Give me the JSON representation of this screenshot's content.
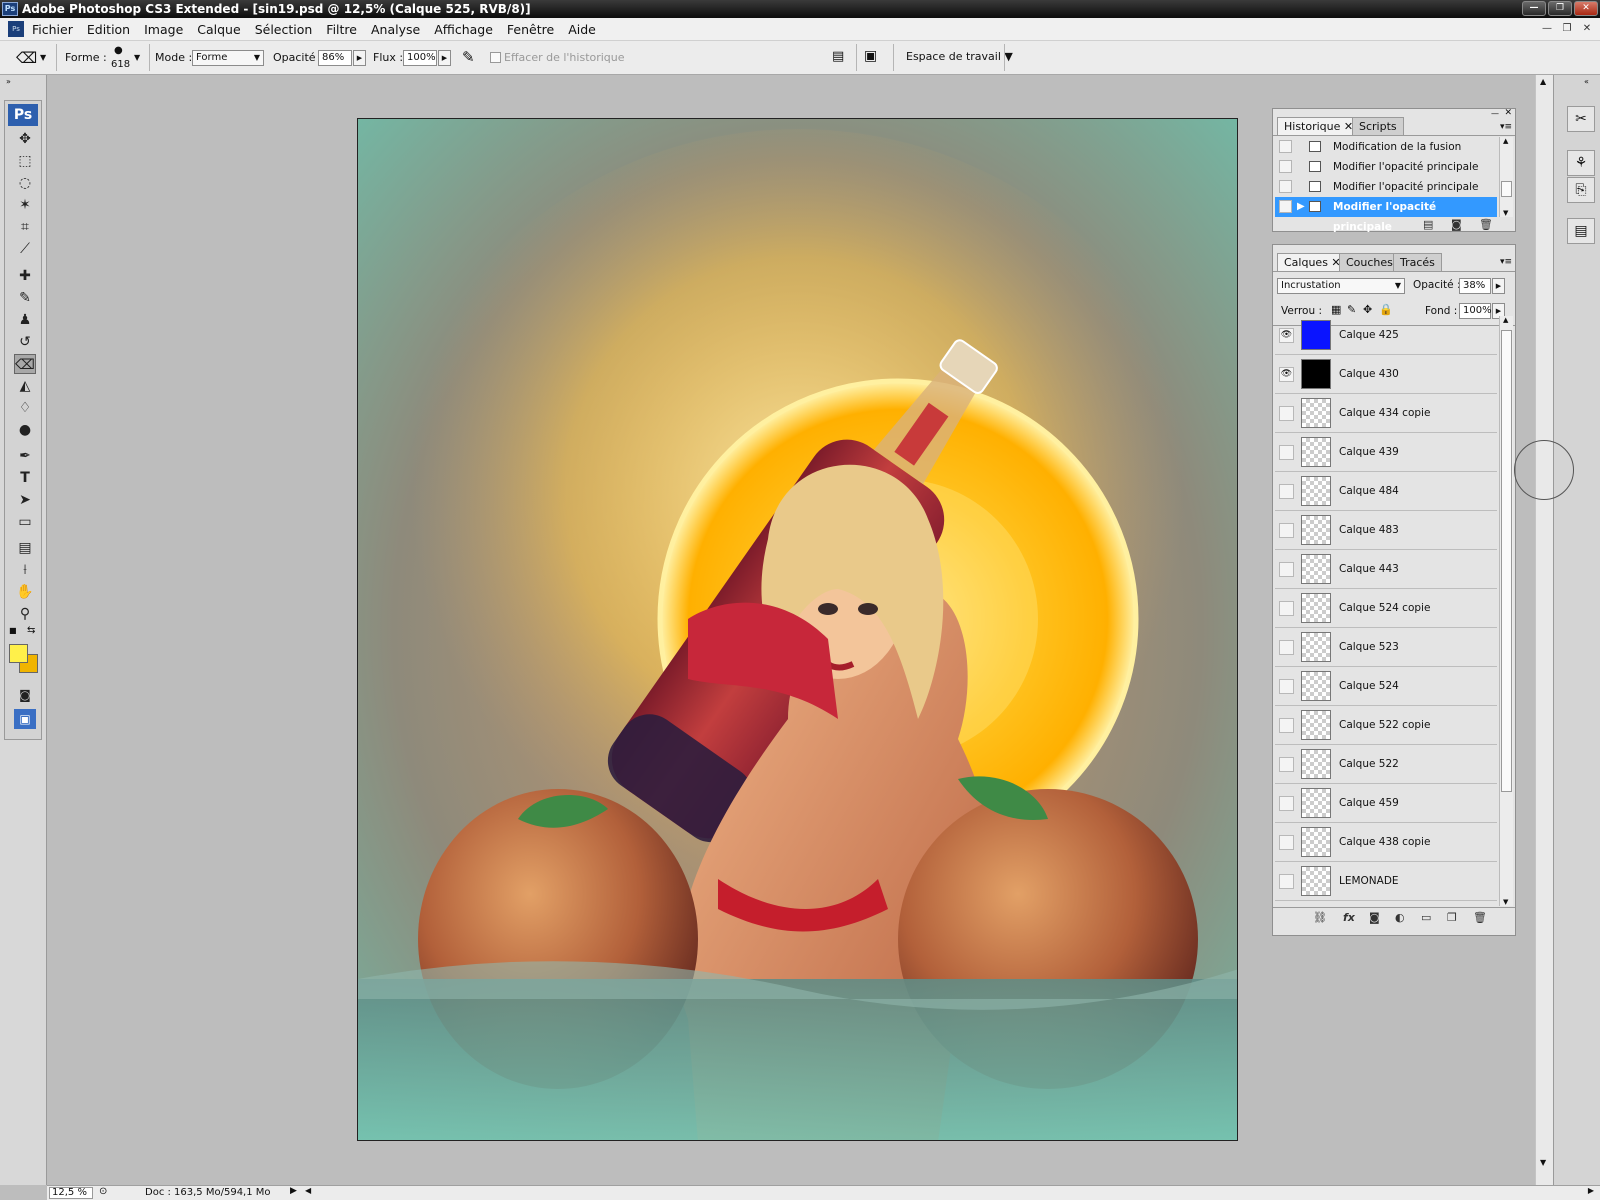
{
  "window": {
    "title": "Adobe Photoshop CS3 Extended - [sin19.psd @ 12,5% (Calque 525, RVB/8)]",
    "app_badge": "Ps"
  },
  "menu": [
    "Fichier",
    "Edition",
    "Image",
    "Calque",
    "Sélection",
    "Filtre",
    "Analyse",
    "Affichage",
    "Fenêtre",
    "Aide"
  ],
  "options": {
    "forme_label": "Forme :",
    "brush_size": "618",
    "mode_label": "Mode :",
    "mode_value": "Forme",
    "opacity_label": "Opacité :",
    "opacity_value": "86%",
    "flux_label": "Flux :",
    "flux_value": "100%",
    "history_erase": "Effacer de l'historique",
    "workspace": "Espace de travail"
  },
  "toolbox": {
    "badge": "Ps",
    "foreground_color": "#fff04a",
    "background_color": "#f0b400"
  },
  "history": {
    "tabs": [
      "Historique",
      "Scripts"
    ],
    "items": [
      {
        "label": "Modification de la fusion"
      },
      {
        "label": "Modifier l'opacité principale"
      },
      {
        "label": "Modifier l'opacité principale"
      },
      {
        "label": "Modifier l'opacité principale",
        "selected": true
      }
    ]
  },
  "layers": {
    "tabs": [
      "Calques",
      "Couches",
      "Tracés"
    ],
    "blend_mode": "Incrustation",
    "opacity_label": "Opacité :",
    "opacity_value": "38%",
    "lock_label": "Verrou :",
    "fill_label": "Fond :",
    "fill_value": "100%",
    "items": [
      {
        "name": "Calque 425",
        "visible": true,
        "thumb": "#0a14ff"
      },
      {
        "name": "Calque 430",
        "visible": true,
        "thumb": "#000000"
      },
      {
        "name": "Calque 434 copie",
        "visible": false
      },
      {
        "name": "Calque 439",
        "visible": false
      },
      {
        "name": "Calque 484",
        "visible": false
      },
      {
        "name": "Calque 483",
        "visible": false
      },
      {
        "name": "Calque 443",
        "visible": false
      },
      {
        "name": "Calque 524 copie",
        "visible": false
      },
      {
        "name": "Calque 523",
        "visible": false
      },
      {
        "name": "Calque 524",
        "visible": false
      },
      {
        "name": "Calque 522 copie",
        "visible": false
      },
      {
        "name": "Calque 522",
        "visible": false
      },
      {
        "name": "Calque 459",
        "visible": false
      },
      {
        "name": "Calque 438 copie",
        "visible": false
      },
      {
        "name": "LEMONADE",
        "visible": false
      }
    ]
  },
  "status": {
    "zoom": "12,5 %",
    "doc": "Doc : 163,5 Mo/594,1 Mo"
  }
}
